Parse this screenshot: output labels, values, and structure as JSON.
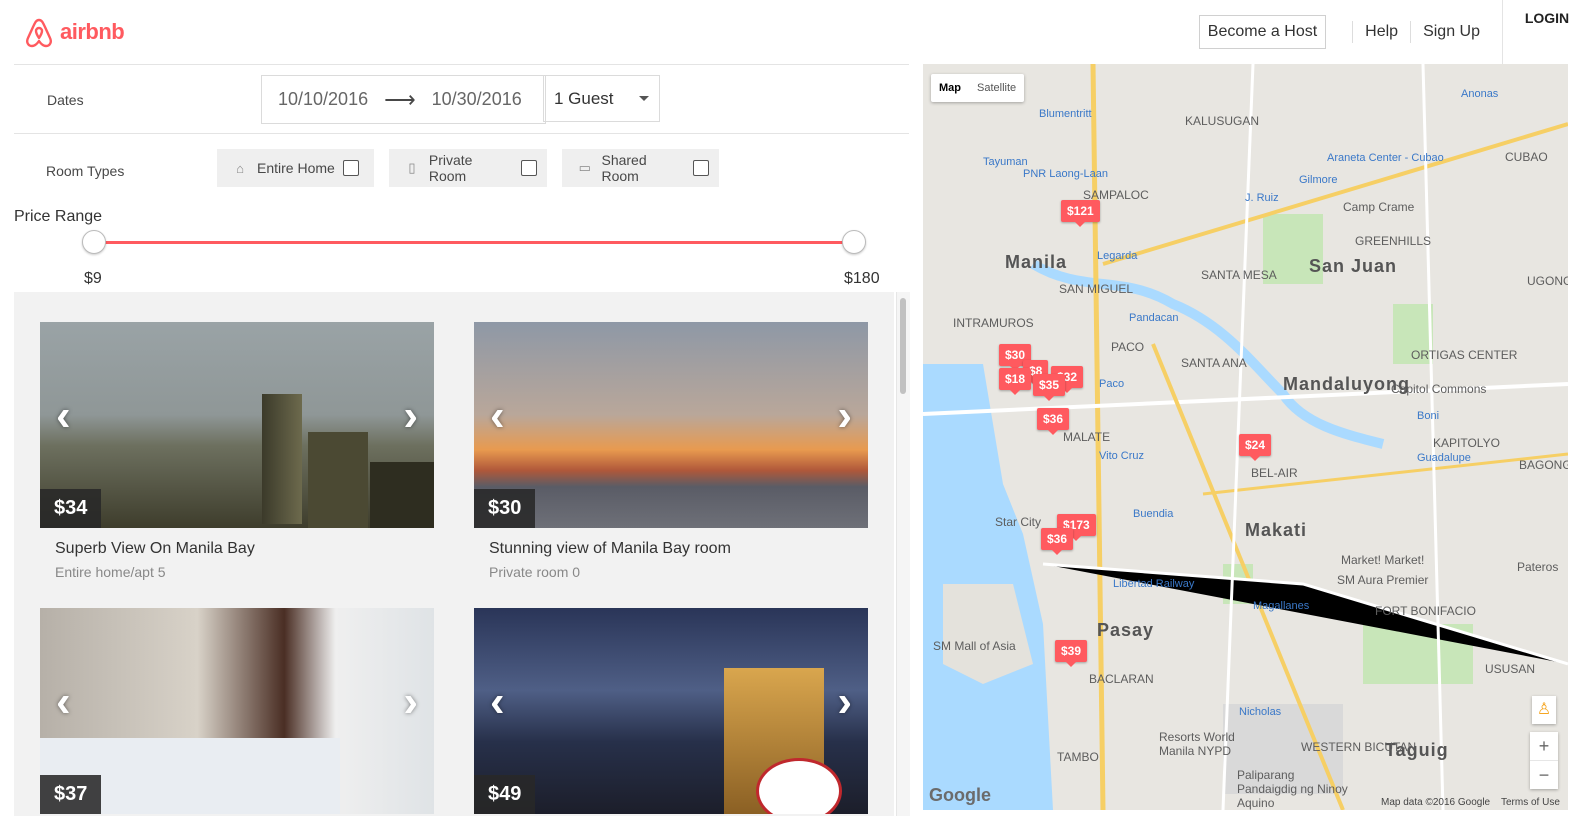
{
  "header": {
    "brand": "airbnb",
    "become_host": "Become a Host",
    "help": "Help",
    "sign_up": "Sign Up",
    "login": "LOGIN"
  },
  "filters": {
    "dates_label": "Dates",
    "start_date": "10/10/2016",
    "arrow": "⟶",
    "end_date": "10/30/2016",
    "guests": "1 Guest",
    "room_types_label": "Room Types",
    "room_types": [
      {
        "label": "Entire Home",
        "icon": "home-icon",
        "checked": false
      },
      {
        "label": "Private Room",
        "icon": "door-icon",
        "checked": false
      },
      {
        "label": "Shared Room",
        "icon": "couch-icon",
        "checked": false
      }
    ],
    "price_range_label": "Price Range",
    "price_min": "$9",
    "price_max": "$180"
  },
  "listings": [
    {
      "price": "$34",
      "title": "Superb View On Manila Bay",
      "subtitle": "Entire home/apt 5"
    },
    {
      "price": "$30",
      "title": "Stunning view of Manila Bay room",
      "subtitle": "Private room 0"
    },
    {
      "price": "$37",
      "title": "",
      "subtitle": ""
    },
    {
      "price": "$49",
      "title": "",
      "subtitle": ""
    }
  ],
  "map": {
    "type_map": "Map",
    "type_satellite": "Satellite",
    "pins": [
      "$121",
      "$30",
      "$8",
      "$32",
      "$18",
      "$35",
      "$36",
      "$24",
      "$173",
      "$36",
      "$39"
    ],
    "places_big": [
      "Manila",
      "San Juan",
      "Mandaluyong",
      "Makati",
      "Pasay",
      "Taguig"
    ],
    "places": [
      "SAMPALOC",
      "SAN MIGUEL",
      "SANTA MESA",
      "GREENHILLS",
      "KALUSUGAN",
      "PACO",
      "SANTA ANA",
      "ORTIGAS CENTER",
      "BEL-AIR",
      "MALATE",
      "INTRAMUROS",
      "KAPITOLYO",
      "BAGONG ILOG",
      "FORT BONIFACIO",
      "USUSAN",
      "BACLARAN",
      "TAMBO",
      "WESTERN BICUTAN",
      "UGONG NOR",
      "CUBAO",
      "Camp Crame",
      "Capitol Commons",
      "Market! Market!",
      "SM Aura Premier",
      "Star City",
      "SM Mall of Asia",
      "Resorts World Manila NYPD",
      "Paliparang Pandaigdig ng Ninoy Aquino",
      "Pateros"
    ],
    "stations": [
      "Blumentritt",
      "Tayuman",
      "PNR Laong-Laan",
      "Legarda",
      "Pandacan",
      "Paco",
      "Vito Cruz",
      "Buendia",
      "Libertad Railway",
      "Magallanes",
      "Nicholas",
      "Gilmore",
      "J. Ruiz",
      "Araneta Center - Cubao",
      "Anonas",
      "Guadalupe",
      "Boni"
    ],
    "google": "Google",
    "attribution": "Map data ©2016 Google",
    "terms": "Terms of Use"
  }
}
